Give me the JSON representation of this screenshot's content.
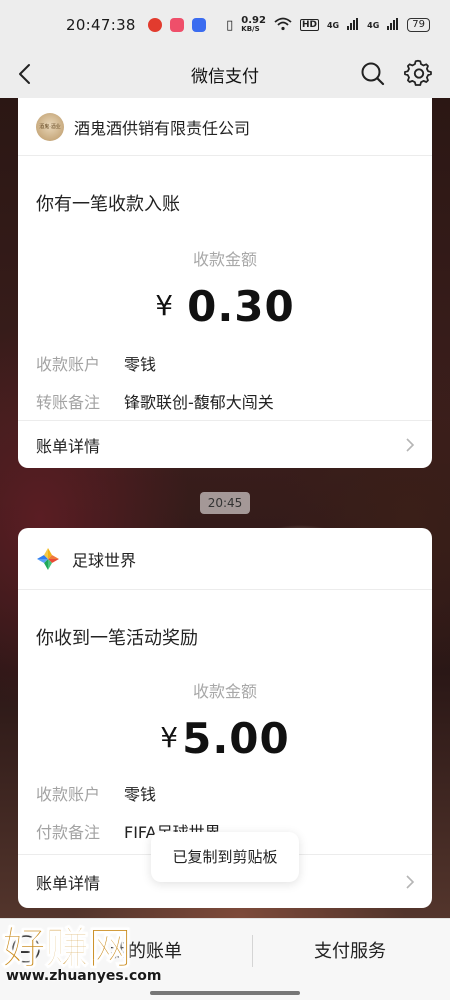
{
  "status_bar": {
    "time": "20:47:38",
    "network_speed": "0.92",
    "network_speed_unit": "KB/S",
    "hd_label": "HD",
    "signal_1": "4G",
    "signal_2": "4G",
    "battery": "79"
  },
  "nav": {
    "title": "微信支付"
  },
  "cards": [
    {
      "merchant": "酒鬼酒供销有限责任公司",
      "logo_text": "酒鬼·酒业",
      "message": "你有一笔收款入账",
      "amount_label": "收款金额",
      "currency": "¥",
      "amount": "0.30",
      "rows": [
        {
          "key": "收款账户",
          "value": "零钱"
        },
        {
          "key": "转账备注",
          "value": "锋歌联创-馥郁大闯关"
        }
      ],
      "footer": "账单详情"
    },
    {
      "merchant": "足球世界",
      "message": "你收到一笔活动奖励",
      "amount_label": "收款金额",
      "currency": "¥",
      "amount": "5.00",
      "rows": [
        {
          "key": "收款账户",
          "value": "零钱"
        },
        {
          "key": "付款备注",
          "value": "FIFA足球世界"
        }
      ],
      "footer": "账单详情"
    }
  ],
  "timestamp": "20:45",
  "toast": "已复制到剪贴板",
  "bottom_bar": {
    "left_tab": "我的账单",
    "right_tab": "支付服务"
  },
  "watermark": {
    "brand": "好赚网",
    "domain": "www.zhuanyes.com"
  },
  "colors": {
    "accent_yellow": "#c98a1a",
    "page_bg": "#ededed"
  }
}
